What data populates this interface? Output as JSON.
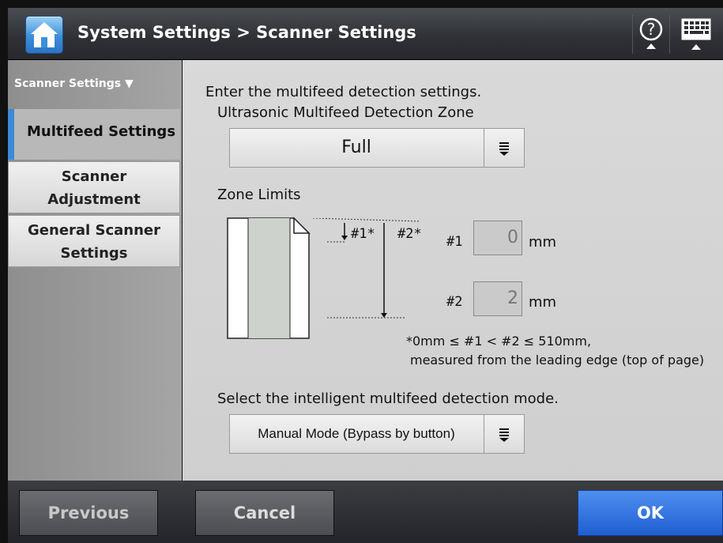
{
  "title": "System Settings > Scanner Settings",
  "sidebar": {
    "header": "Scanner Settings ▼",
    "items": [
      {
        "label": "Multifeed Settings"
      },
      {
        "label": "Scanner\nAdjustment"
      },
      {
        "label": "General Scanner\nSettings"
      }
    ]
  },
  "main": {
    "intro": "Enter the multifeed detection settings.",
    "zone_label": "Ultrasonic Multifeed Detection Zone",
    "zone_value": "Full",
    "zone_limits_label": "Zone Limits",
    "diagram": {
      "label1": "#1*",
      "label2": "#2*"
    },
    "limit1": {
      "label": "#1",
      "value": "0",
      "unit": "mm"
    },
    "limit2": {
      "label": "#2",
      "value": "2",
      "unit": "mm"
    },
    "note_line1": "*0mm ≤ #1 < #2 ≤ 510mm,",
    "note_line2": "measured from the leading edge (top of page)",
    "mode_label": "Select the intelligent multifeed detection mode.",
    "mode_value": "Manual Mode (Bypass by button)"
  },
  "footer": {
    "previous": "Previous",
    "cancel": "Cancel",
    "ok": "OK"
  },
  "colors": {
    "accent": "#3a8ad8",
    "ok_button": "#2a6ee0"
  },
  "icons": [
    "home-icon",
    "help-icon",
    "keyboard-icon",
    "dropdown-icon",
    "document-icon"
  ]
}
